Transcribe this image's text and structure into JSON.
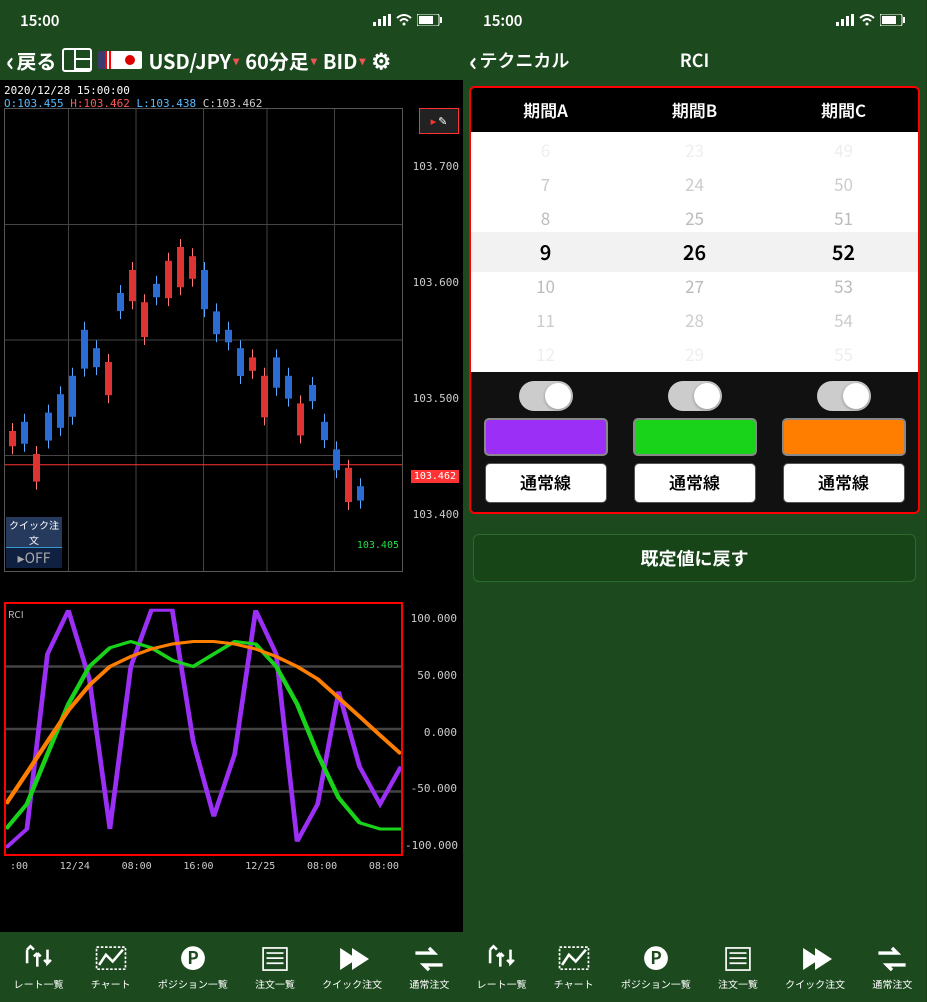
{
  "status": {
    "time": "15:00"
  },
  "left": {
    "back_label": "戻る",
    "pair": "USD/JPY",
    "timeframe": "60分足",
    "price_type": "BID",
    "datetime": "2020/12/28 15:00:00",
    "ohlc": {
      "o": "103.455",
      "h": "103.462",
      "l": "103.438",
      "c": "103.462"
    },
    "price_axis": [
      "103.700",
      "103.600",
      "103.500",
      "103.400"
    ],
    "last_price": "103.462",
    "low_mark": "103.405",
    "quick_order_label": "クイック注文",
    "quick_order_state": "OFF",
    "rci_label": "RCI",
    "rci_axis": [
      "100.000",
      "50.000",
      "0.000",
      "-50.000",
      "-100.000"
    ],
    "time_axis": [
      ":00",
      "12/24",
      "08:00",
      "16:00",
      "12/25",
      "08:00",
      "08:00"
    ]
  },
  "right": {
    "back_label": "テクニカル",
    "title": "RCI",
    "columns": {
      "a": "期間A",
      "b": "期間B",
      "c": "期間C"
    },
    "picker": {
      "a": {
        "items": [
          "6",
          "7",
          "8",
          "9",
          "10",
          "11",
          "12"
        ],
        "selected": "9"
      },
      "b": {
        "items": [
          "23",
          "24",
          "25",
          "26",
          "27",
          "28",
          "29"
        ],
        "selected": "26"
      },
      "c": {
        "items": [
          "49",
          "50",
          "51",
          "52",
          "53",
          "54",
          "55"
        ],
        "selected": "52"
      }
    },
    "colors": {
      "a": "#9b2ff5",
      "b": "#18d31a",
      "c": "#ff7e00"
    },
    "linetype_label": "通常線",
    "reset_label": "既定値に戻す"
  },
  "tabs": {
    "rates": "レート一覧",
    "chart": "チャート",
    "positions": "ポジション一覧",
    "orders": "注文一覧",
    "quick": "クイック注文",
    "normal": "通常注文"
  },
  "chart_data": {
    "type": "line",
    "title": "RCI",
    "ylim": [
      -100,
      100
    ],
    "x": [
      0,
      1,
      2,
      3,
      4,
      5,
      6,
      7,
      8,
      9,
      10,
      11,
      12,
      13,
      14,
      15,
      16,
      17,
      18,
      19
    ],
    "series": [
      {
        "name": "期間A",
        "values": [
          -95,
          -80,
          60,
          95,
          40,
          -80,
          50,
          95,
          95,
          -10,
          -70,
          -20,
          95,
          60,
          -90,
          -60,
          30,
          -30,
          -60,
          -30
        ]
      },
      {
        "name": "期間B",
        "values": [
          -80,
          -60,
          -20,
          20,
          50,
          65,
          70,
          65,
          55,
          50,
          60,
          70,
          68,
          50,
          20,
          -20,
          -55,
          -75,
          -80,
          -80
        ]
      },
      {
        "name": "期間C",
        "values": [
          -60,
          -35,
          -10,
          15,
          35,
          50,
          58,
          64,
          68,
          70,
          70,
          68,
          64,
          58,
          50,
          40,
          25,
          10,
          -5,
          -20
        ]
      }
    ]
  }
}
